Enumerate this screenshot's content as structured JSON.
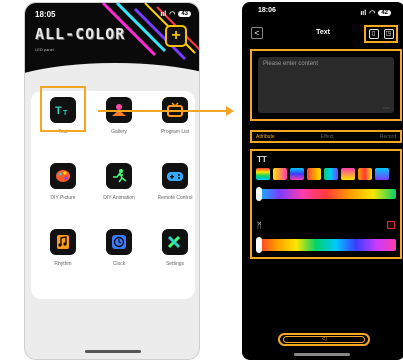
{
  "left_phone": {
    "status": {
      "time": "18:05",
      "signal": "ııl",
      "battery": "43"
    },
    "brand": {
      "logo_text": "ALL-COLOR",
      "subtitle": "LED panel"
    },
    "add_button": "+",
    "apps": [
      {
        "label": "Text",
        "icon": "text-icon",
        "selected": true
      },
      {
        "label": "Gallery",
        "icon": "gallery-icon"
      },
      {
        "label": "Program List",
        "icon": "tv-icon"
      },
      {
        "label": "DIY Picture",
        "icon": "palette-icon"
      },
      {
        "label": "DIY Animation",
        "icon": "runner-icon"
      },
      {
        "label": "Remote Control",
        "icon": "gamepad-icon"
      },
      {
        "label": "Rhythm",
        "icon": "music-note-icon"
      },
      {
        "label": "Clock",
        "icon": "clock-icon"
      },
      {
        "label": "Settings",
        "icon": "tools-icon"
      }
    ]
  },
  "right_phone": {
    "status": {
      "time": "18:06",
      "signal": "ııl",
      "battery": "42"
    },
    "nav": {
      "back": "<",
      "title": "Text"
    },
    "input": {
      "placeholder": "Please enter content",
      "counter": "0/300"
    },
    "tabs": [
      {
        "label": "Attribute",
        "active": true
      },
      {
        "label": "Effect",
        "active": false
      },
      {
        "label": "Record",
        "active": false
      }
    ],
    "text_color_icon": "TT",
    "background_icon": "ᛗ",
    "send_icon": "◁"
  },
  "colors": {
    "accent": "#f5a623",
    "brand_yellow": "#f5c000",
    "dark": "#000000"
  }
}
